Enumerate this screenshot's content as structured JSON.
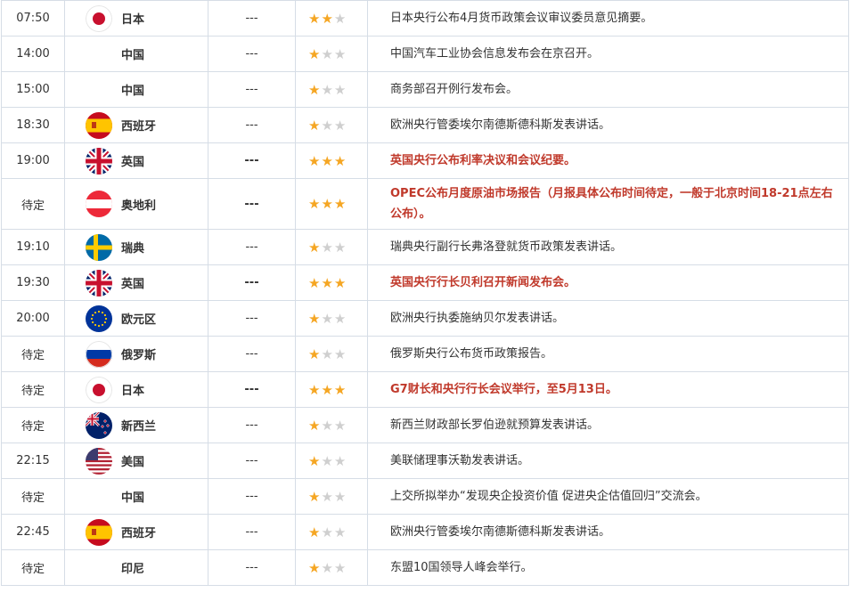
{
  "empty_value": "---",
  "colors": {
    "important": "#c0392b",
    "star_on": "#f5a623",
    "star_off": "#cfcfcf",
    "border": "#d6dde6"
  },
  "rows": [
    {
      "time": "07:50",
      "country": "日本",
      "flag": "japan-flag-icon",
      "value": "---",
      "stars": 2,
      "important": false,
      "event": "日本央行公布4月货币政策会议审议委员意见摘要。"
    },
    {
      "time": "14:00",
      "country": "中国",
      "flag": "",
      "value": "---",
      "stars": 1,
      "important": false,
      "event": "中国汽车工业协会信息发布会在京召开。"
    },
    {
      "time": "15:00",
      "country": "中国",
      "flag": "",
      "value": "---",
      "stars": 1,
      "important": false,
      "event": "商务部召开例行发布会。"
    },
    {
      "time": "18:30",
      "country": "西班牙",
      "flag": "spain-flag-icon",
      "value": "---",
      "stars": 1,
      "important": false,
      "event": "欧洲央行管委埃尔南德斯德科斯发表讲话。"
    },
    {
      "time": "19:00",
      "country": "英国",
      "flag": "uk-flag-icon",
      "value": "---",
      "stars": 3,
      "important": true,
      "event": "英国央行公布利率决议和会议纪要。"
    },
    {
      "time": "待定",
      "country": "奥地利",
      "flag": "austria-flag-icon",
      "value": "---",
      "stars": 3,
      "important": true,
      "event": "OPEC公布月度原油市场报告（月报具体公布时间待定，一般于北京时间18-21点左右公布）。"
    },
    {
      "time": "19:10",
      "country": "瑞典",
      "flag": "sweden-flag-icon",
      "value": "---",
      "stars": 1,
      "important": false,
      "event": "瑞典央行副行长弗洛登就货币政策发表讲话。"
    },
    {
      "time": "19:30",
      "country": "英国",
      "flag": "uk-flag-icon",
      "value": "---",
      "stars": 3,
      "important": true,
      "event": "英国央行行长贝利召开新闻发布会。"
    },
    {
      "time": "20:00",
      "country": "欧元区",
      "flag": "eu-flag-icon",
      "value": "---",
      "stars": 1,
      "important": false,
      "event": "欧洲央行执委施纳贝尔发表讲话。"
    },
    {
      "time": "待定",
      "country": "俄罗斯",
      "flag": "russia-flag-icon",
      "value": "---",
      "stars": 1,
      "important": false,
      "event": "俄罗斯央行公布货币政策报告。"
    },
    {
      "time": "待定",
      "country": "日本",
      "flag": "japan-flag-icon",
      "value": "---",
      "stars": 3,
      "important": true,
      "event": "G7财长和央行行长会议举行，至5月13日。"
    },
    {
      "time": "待定",
      "country": "新西兰",
      "flag": "newzealand-flag-icon",
      "value": "---",
      "stars": 1,
      "important": false,
      "event": "新西兰财政部长罗伯逊就预算发表讲话。"
    },
    {
      "time": "22:15",
      "country": "美国",
      "flag": "usa-flag-icon",
      "value": "---",
      "stars": 1,
      "important": false,
      "event": "美联储理事沃勒发表讲话。"
    },
    {
      "time": "待定",
      "country": "中国",
      "flag": "",
      "value": "---",
      "stars": 1,
      "important": false,
      "event": "上交所拟举办“发现央企投资价值 促进央企估值回归”交流会。"
    },
    {
      "time": "22:45",
      "country": "西班牙",
      "flag": "spain-flag-icon",
      "value": "---",
      "stars": 1,
      "important": false,
      "event": "欧洲央行管委埃尔南德斯德科斯发表讲话。"
    },
    {
      "time": "待定",
      "country": "印尼",
      "flag": "",
      "value": "---",
      "stars": 1,
      "important": false,
      "event": "东盟10国领导人峰会举行。"
    }
  ]
}
